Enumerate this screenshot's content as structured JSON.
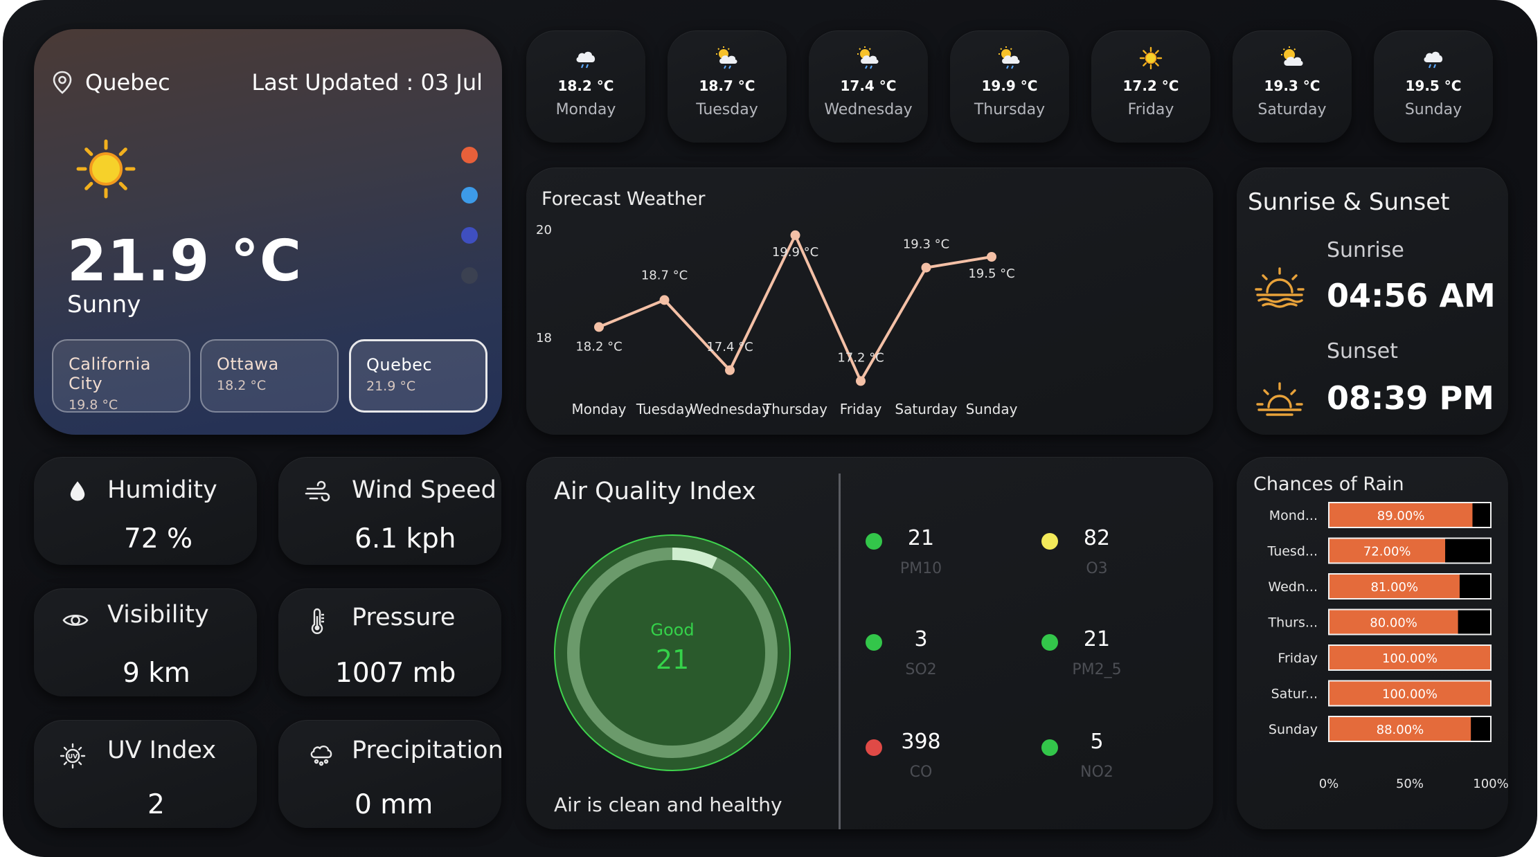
{
  "hero": {
    "location": "Quebec",
    "last_updated": "Last Updated : 03 Jul",
    "temperature": "21.9 °C",
    "condition": "Sunny",
    "icon": "sun-icon",
    "dots": [
      "#e8603a",
      "#3d9be9",
      "#3f4fc0",
      "#3b4151"
    ],
    "cities": [
      {
        "name": "California City",
        "temp": "19.8 °C"
      },
      {
        "name": "Ottawa",
        "temp": "18.2 °C"
      },
      {
        "name": "Quebec",
        "temp": "21.9 °C",
        "active": true
      }
    ]
  },
  "days": [
    {
      "temp": "18.2 °C",
      "name": "Monday",
      "icon": "cloud-rain-icon"
    },
    {
      "temp": "18.7 °C",
      "name": "Tuesday",
      "icon": "sun-cloud-rain-icon"
    },
    {
      "temp": "17.4 °C",
      "name": "Wednesday",
      "icon": "sun-cloud-rain-icon"
    },
    {
      "temp": "19.9 °C",
      "name": "Thursday",
      "icon": "sun-cloud-rain-icon"
    },
    {
      "temp": "17.2 °C",
      "name": "Friday",
      "icon": "sun-icon"
    },
    {
      "temp": "19.3 °C",
      "name": "Saturday",
      "icon": "sun-cloud-icon"
    },
    {
      "temp": "19.5 °C",
      "name": "Sunday",
      "icon": "cloud-rain-icon"
    }
  ],
  "forecast": {
    "title": "Forecast Weather",
    "chart_data": {
      "type": "line",
      "title": "Forecast Weather",
      "categories": [
        "Monday",
        "Tuesday",
        "Wednesday",
        "Thursday",
        "Friday",
        "Saturday",
        "Sunday"
      ],
      "values": [
        18.2,
        18.7,
        17.4,
        19.9,
        17.2,
        19.3,
        19.5
      ],
      "labels": [
        "18.2 °C",
        "18.7 °C",
        "17.4 °C",
        "19.9 °C",
        "17.2 °C",
        "19.3 °C",
        "19.5 °C"
      ],
      "yticks": [
        "20",
        "18"
      ],
      "ytick_values": [
        20,
        18
      ],
      "line_color": "#f4c0a6"
    }
  },
  "sun": {
    "title": "Sunrise & Sunset",
    "sunrise_label": "Sunrise",
    "sunrise": "04:56 AM",
    "sunset_label": "Sunset",
    "sunset": "08:39 PM",
    "icon_color": "#e8a23a"
  },
  "metrics": {
    "humidity": {
      "label": "Humidity",
      "value": "72 %",
      "icon": "drop-icon"
    },
    "wind": {
      "label": "Wind Speed",
      "value": "6.1 kph",
      "icon": "wind-icon"
    },
    "visibility": {
      "label": "Visibility",
      "value": "9 km",
      "icon": "eye-icon"
    },
    "pressure": {
      "label": "Pressure",
      "value": "1007 mb",
      "icon": "thermometer-icon"
    },
    "uv": {
      "label": "UV Index",
      "value": "2",
      "icon": "uv-icon"
    },
    "precip": {
      "label": "Precipitation",
      "value": "0 mm",
      "icon": "cloud-rain-icon"
    }
  },
  "aqi": {
    "title": "Air Quality Index",
    "status": "Good",
    "value": "21",
    "footer": "Air is clean and healthy",
    "ring_color": "#3fd44d",
    "pollutants": [
      {
        "value": "21",
        "name": "PM10",
        "color": "#33c64a"
      },
      {
        "value": "82",
        "name": "O3",
        "color": "#f3ea5a"
      },
      {
        "value": "3",
        "name": "SO2",
        "color": "#33c64a"
      },
      {
        "value": "21",
        "name": "PM2_5",
        "color": "#33c64a"
      },
      {
        "value": "398",
        "name": "CO",
        "color": "#e04a46"
      },
      {
        "value": "5",
        "name": "NO2",
        "color": "#33c64a"
      }
    ]
  },
  "rain": {
    "title": "Chances of Rain",
    "chart_data": {
      "type": "bar",
      "orientation": "horizontal",
      "categories": [
        "Mond...",
        "Tuesd...",
        "Wedn...",
        "Thurs...",
        "Friday",
        "Satur...",
        "Sunday"
      ],
      "values": [
        89,
        72,
        81,
        80,
        100,
        100,
        88
      ],
      "labels": [
        "89.00%",
        "72.00%",
        "81.00%",
        "80.00%",
        "100.00%",
        "100.00%",
        "88.00%"
      ],
      "xticks": [
        "0%",
        "50%",
        "100%"
      ],
      "xlim": [
        0,
        100
      ],
      "bar_color": "#e46b3b"
    }
  }
}
